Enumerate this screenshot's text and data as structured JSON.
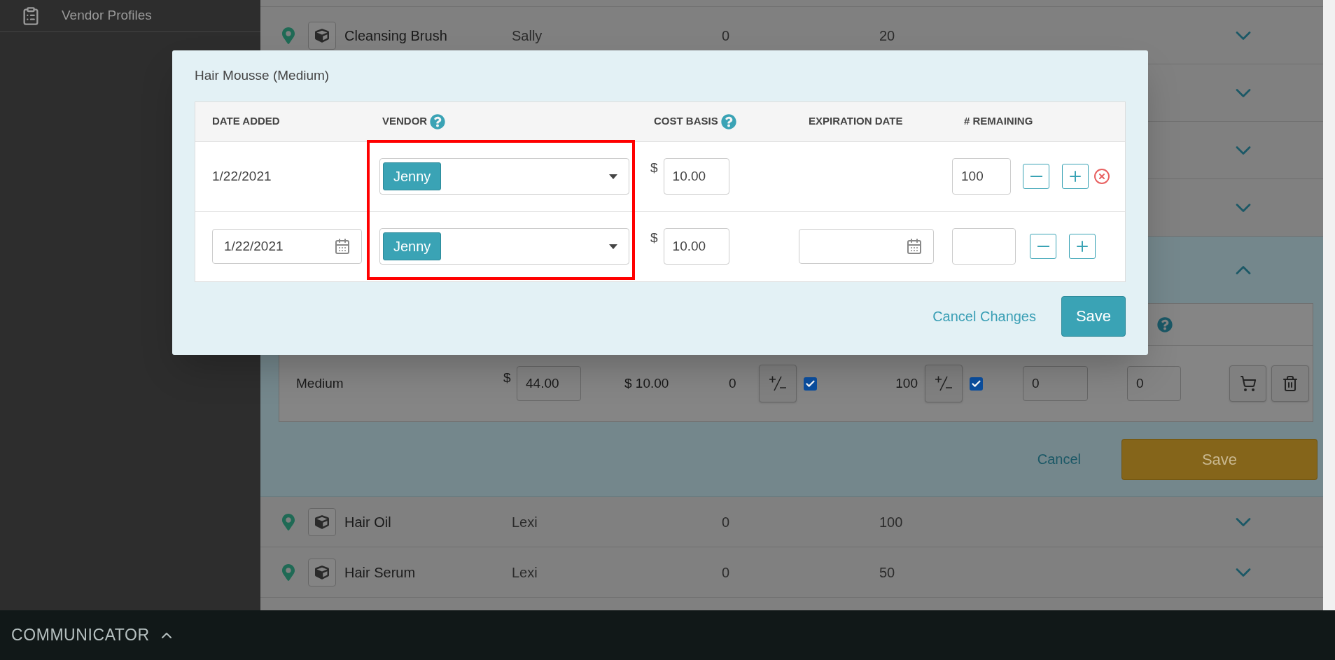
{
  "sidebar": {
    "items": [
      {
        "label": "Vendor Profiles"
      }
    ]
  },
  "products": [
    {
      "kind": "row",
      "name": "Cleansing Brush",
      "vendor": "Sally",
      "column_3": "0",
      "column_4": "20",
      "expanded": false
    },
    {
      "kind": "row",
      "expanded": false
    },
    {
      "kind": "row",
      "expanded": false
    },
    {
      "kind": "row",
      "expanded": false
    },
    {
      "kind": "detail",
      "expanded": true,
      "variant": {
        "name": "Medium",
        "currency": "$",
        "price": "44.00",
        "cost": "$ 10.00",
        "column_4": "0",
        "column_4_checked": true,
        "column_5": "100",
        "column_5_checked": true,
        "field_1": "0",
        "field_2": "0"
      },
      "cancel": "Cancel",
      "save": "Save"
    },
    {
      "kind": "row",
      "name": "Hair Oil",
      "vendor": "Lexi",
      "column_3": "0",
      "column_4": "100",
      "expanded": false
    },
    {
      "kind": "row",
      "name": "Hair Serum",
      "vendor": "Lexi",
      "column_3": "0",
      "column_4": "50",
      "expanded": false
    }
  ],
  "communicator": {
    "label": "COMMUNICATOR"
  },
  "modal": {
    "title": "Hair Mousse (Medium)",
    "columns": [
      {
        "label": "DATE ADDED",
        "help": false
      },
      {
        "label": "VENDOR",
        "help": true
      },
      {
        "label": "COST BASIS",
        "help": true
      },
      {
        "label": "EXPIRATION DATE",
        "help": false
      },
      {
        "label": "# REMAINING",
        "help": false
      }
    ],
    "rows": [
      {
        "kind": "saved",
        "date_added": "1/22/2021",
        "vendor": "Jenny",
        "currency": "$",
        "cost_basis": "10.00",
        "remaining": "100"
      },
      {
        "kind": "new",
        "date_added": "1/22/2021",
        "vendor": "Jenny",
        "currency": "$",
        "cost_basis": "10.00"
      }
    ],
    "cancel": "Cancel Changes",
    "save": "Save"
  }
}
